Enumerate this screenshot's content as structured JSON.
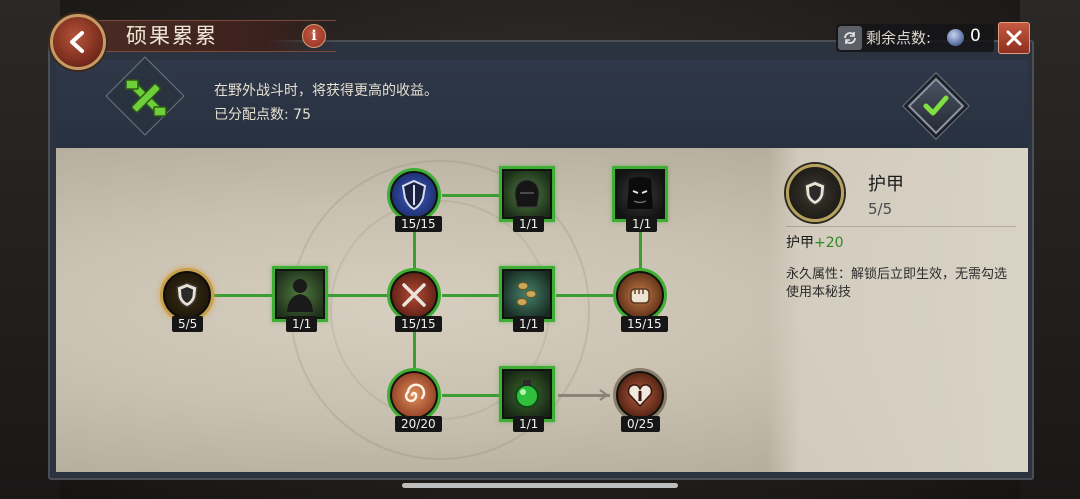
{
  "header": {
    "title": "硕果累累",
    "info_icon": "i",
    "points_label": "剩余点数:",
    "points_value": "0"
  },
  "banner": {
    "description": "在野外战斗时，将获得更高的收益。",
    "allocated": "已分配点数: 75"
  },
  "nodes": {
    "armor": "5/5",
    "shadow_figure": "1/1",
    "blue_shield": "15/15",
    "crossed_swords": "15/15",
    "spiral": "20/20",
    "dark_helmet": "1/1",
    "coins": "1/1",
    "green_orb": "1/1",
    "dark_face": "1/1",
    "fist": "15/15",
    "heart": "0/25"
  },
  "detail": {
    "title": "护甲",
    "level": "5/5",
    "stat_label": "护甲",
    "stat_value": "+20",
    "description": "永久属性：解锁后立即生效，无需勾选使用本秘技"
  },
  "colors": {
    "connector": "#3d9d35",
    "node_border": "#3fae34",
    "accent_red": "#b5543b"
  }
}
